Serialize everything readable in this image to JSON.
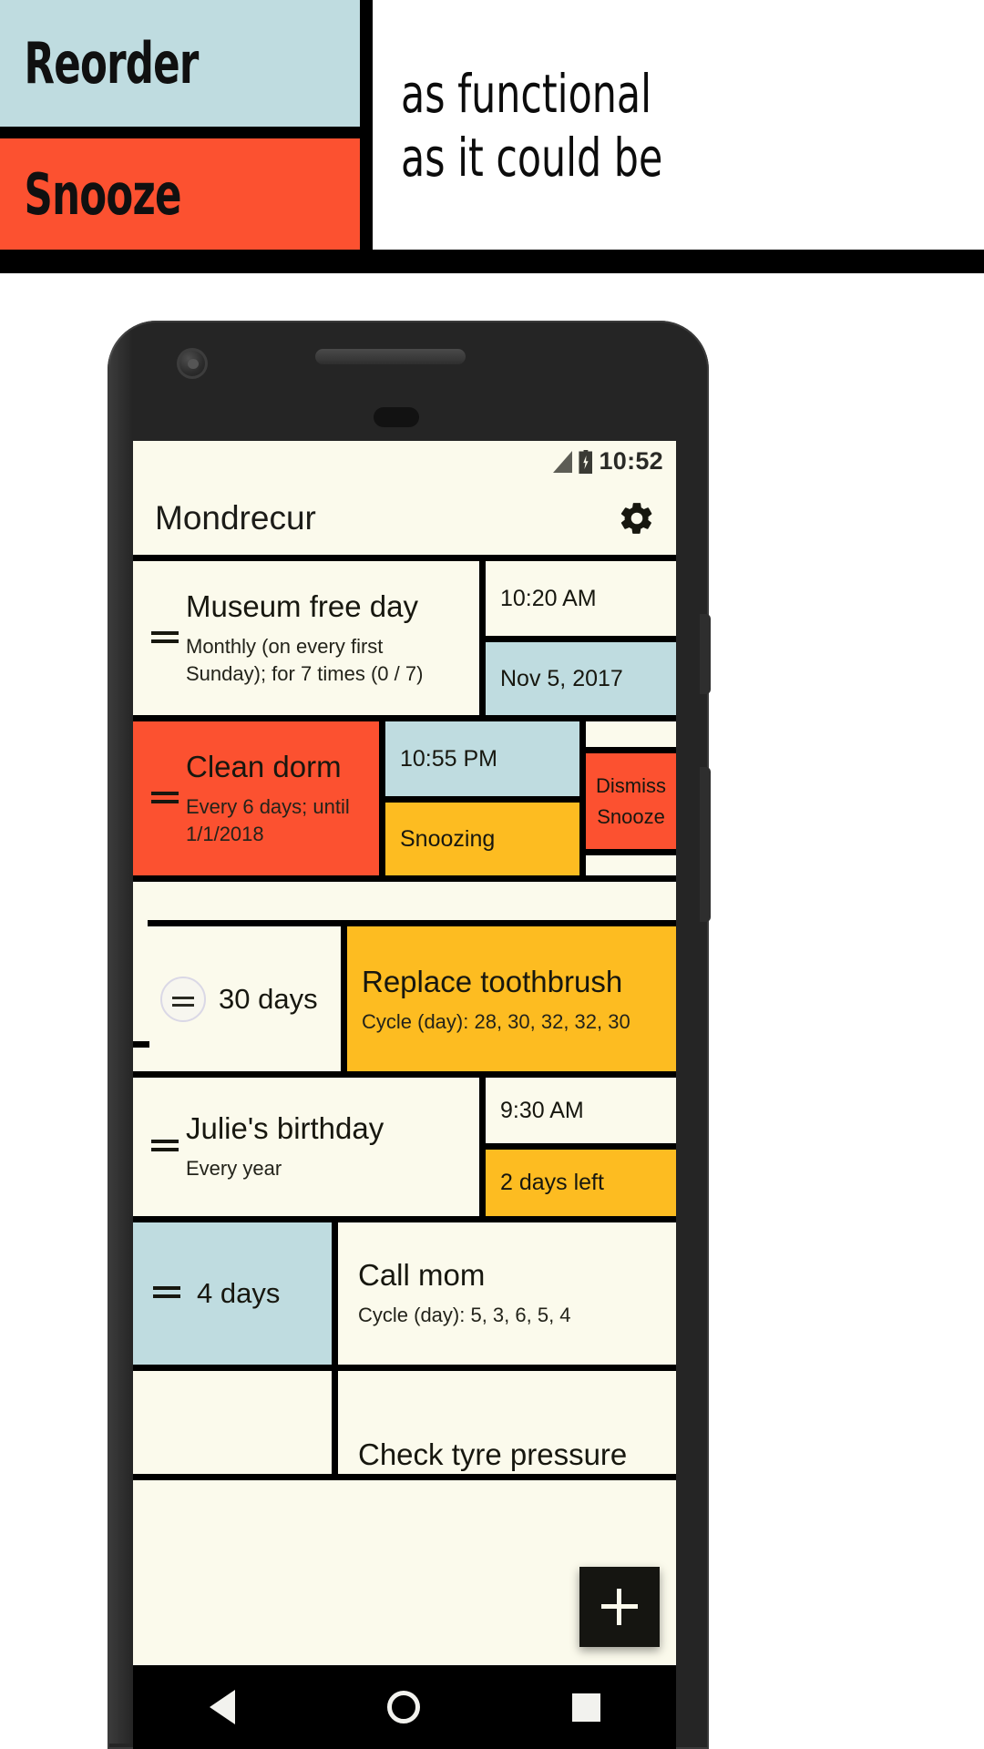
{
  "promo": {
    "badges": [
      {
        "label": "Reorder",
        "color": "#bfdce0"
      },
      {
        "label": "Snooze",
        "color": "#fc5130"
      }
    ],
    "tagline_line1": "as functional",
    "tagline_line2": "as it could be"
  },
  "phone": {
    "status_bar": {
      "time": "10:52",
      "signal_icon": "signal-triangle-icon",
      "battery_icon": "battery-charging-icon"
    },
    "app_bar": {
      "title": "Mondrecur",
      "settings_icon": "gear-icon"
    },
    "fab": {
      "label": "+",
      "icon": "plus-icon"
    },
    "nav_bar": {
      "back_icon": "back-triangle-icon",
      "home_icon": "home-circle-icon",
      "recents_icon": "recents-square-icon"
    }
  },
  "colors": {
    "cream": "#fbfaec",
    "blue": "#bfdce0",
    "amber": "#fdbc21",
    "orange": "#fc5130",
    "black": "#000000"
  },
  "list": [
    {
      "id": "museum-free-day",
      "title": "Museum free day",
      "subtitle": "Monthly (on every first Sunday); for 7 times (0 / 7)",
      "main_color": "#fbfaec",
      "handle_icon": "drag-handle-icon",
      "side": [
        {
          "text": "10:20 AM",
          "color": "#fbfaec"
        },
        {
          "text": "Nov 5, 2017",
          "color": "#bfdce0"
        }
      ]
    },
    {
      "id": "clean-dorm",
      "title": "Clean dorm",
      "subtitle": "Every 6 days; until 1/1/2018",
      "main_color": "#fc5130",
      "handle_icon": "drag-handle-icon",
      "side": [
        {
          "text": "10:55 PM",
          "color": "#bfdce0"
        },
        {
          "text": "Snoozing",
          "color": "#fdbc21"
        }
      ],
      "action_button": {
        "line1": "Dismiss",
        "line2": "Snooze",
        "color": "#fc5130"
      }
    },
    {
      "id": "replace-toothbrush",
      "title": "Replace toothbrush",
      "subtitle": "Cycle (day): 28, 30, 32, 32, 30",
      "main_color": "#fdbc21",
      "dragging": true,
      "drag_label": "30 days",
      "handle_icon": "circle-drag-handle-icon"
    },
    {
      "id": "julies-birthday",
      "title": "Julie's birthday",
      "subtitle": "Every year",
      "main_color": "#fbfaec",
      "handle_icon": "drag-handle-icon",
      "side": [
        {
          "text": "9:30 AM",
          "color": "#fbfaec"
        },
        {
          "text": "2 days left",
          "color": "#fdbc21"
        }
      ]
    },
    {
      "id": "call-mom",
      "title": "Call mom",
      "subtitle": "Cycle (day): 5, 3, 6, 5, 4",
      "main_color": "#fbfaec",
      "handle_icon": "drag-handle-icon",
      "lead_label": "4 days",
      "lead_color": "#bfdce0"
    },
    {
      "id": "check-tyre-pressure",
      "title": "Check tyre pressure",
      "subtitle": "",
      "main_color": "#fbfaec",
      "handle_icon": "drag-handle-icon",
      "lead_label": "",
      "lead_color": "#fbfaec"
    }
  ]
}
